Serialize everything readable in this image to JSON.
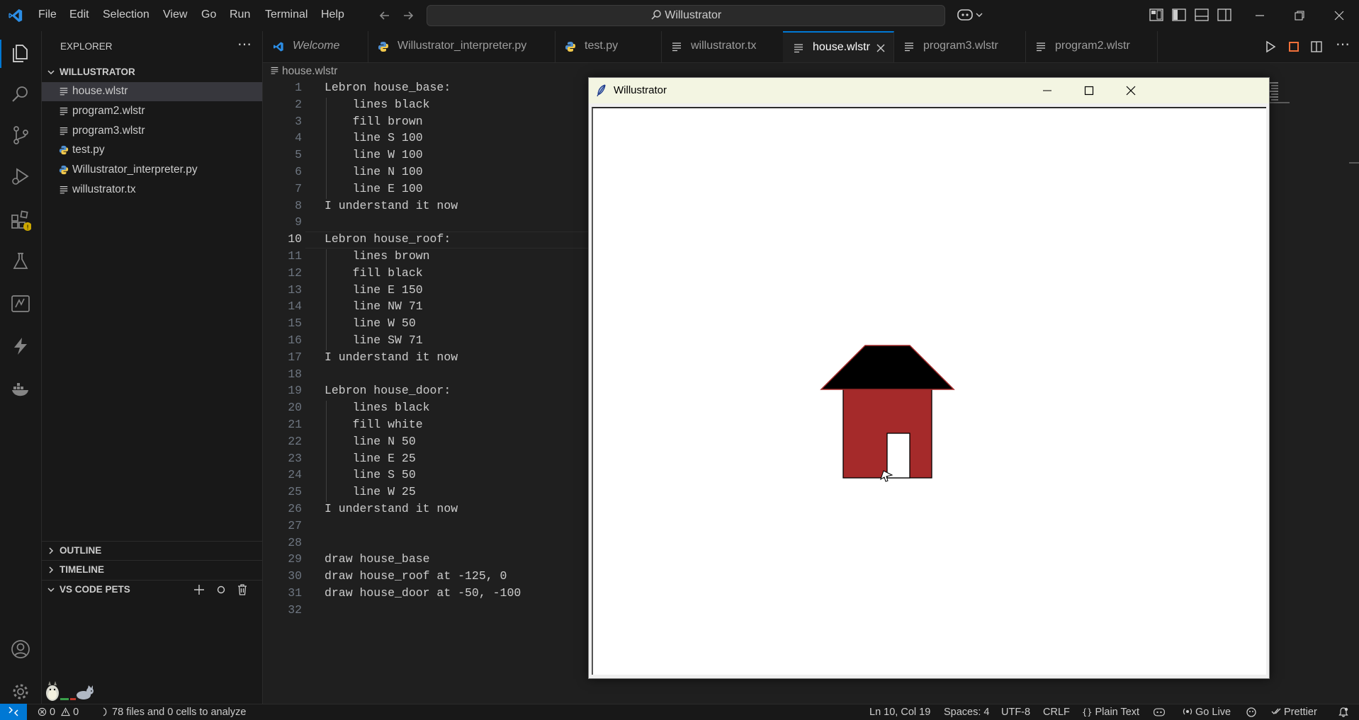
{
  "menu": [
    "File",
    "Edit",
    "Selection",
    "View",
    "Go",
    "Run",
    "Terminal",
    "Help"
  ],
  "search": {
    "text": "Willustrator"
  },
  "explorer": {
    "title": "EXPLORER",
    "folder": "WILLUSTRATOR",
    "files": [
      {
        "name": "house.wlstr",
        "type": "text"
      },
      {
        "name": "program2.wlstr",
        "type": "text"
      },
      {
        "name": "program3.wlstr",
        "type": "text"
      },
      {
        "name": "test.py",
        "type": "python"
      },
      {
        "name": "Willustrator_interpreter.py",
        "type": "python"
      },
      {
        "name": "willustrator.tx",
        "type": "text"
      }
    ],
    "sections": [
      "OUTLINE",
      "TIMELINE",
      "VS CODE PETS"
    ]
  },
  "tabs": [
    {
      "label": "Welcome",
      "type": "vscode"
    },
    {
      "label": "Willustrator_interpreter.py",
      "type": "python"
    },
    {
      "label": "test.py",
      "type": "python"
    },
    {
      "label": "willustrator.tx",
      "type": "text"
    },
    {
      "label": "house.wlstr",
      "type": "text",
      "active": true
    },
    {
      "label": "program3.wlstr",
      "type": "text"
    },
    {
      "label": "program2.wlstr",
      "type": "text"
    }
  ],
  "breadcrumb": "house.wlstr",
  "editor": {
    "current_line": 10,
    "lines": [
      "Lebron house_base:",
      "    lines black",
      "    fill brown",
      "    line S 100",
      "    line W 100",
      "    line N 100",
      "    line E 100",
      "I understand it now",
      "",
      "Lebron house_roof:",
      "    lines brown",
      "    fill black",
      "    line E 150",
      "    line NW 71",
      "    line W 50",
      "    line SW 71",
      "I understand it now",
      "",
      "Lebron house_door:",
      "    lines black",
      "    fill white",
      "    line N 50",
      "    line E 25",
      "    line S 50",
      "    line W 25",
      "I understand it now",
      "",
      "",
      "draw house_base",
      "draw house_roof at -125, 0",
      "draw house_door at -50, -100",
      ""
    ]
  },
  "window": {
    "title": "Willustrator"
  },
  "colors": {
    "accent": "#0078d4",
    "house_base": "#a52a2a",
    "roof": "#000000",
    "roof_outline": "#a52a2a",
    "door": "#ffffff"
  },
  "status": {
    "errors": "0",
    "warnings": "0",
    "analysis": "78 files and 0 cells to analyze",
    "position": "Ln 10, Col 19",
    "spaces": "Spaces: 4",
    "encoding": "UTF-8",
    "eol": "CRLF",
    "language": "Plain Text",
    "golive": "Go Live",
    "prettier": "Prettier"
  }
}
